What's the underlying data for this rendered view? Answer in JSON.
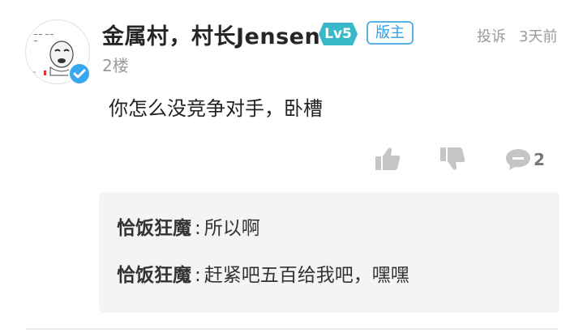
{
  "post": {
    "username": "金属村，村长Jensen",
    "level": "Lv5",
    "owner_badge": "版主",
    "report": "投诉",
    "time": "3天前",
    "floor": "2楼",
    "content": "你怎么没竞争对手，卧槽",
    "reply_count": "2"
  },
  "replies": [
    {
      "author": "恰饭狂魔",
      "sep": ":",
      "text": "所以啊"
    },
    {
      "author": "恰饭狂魔",
      "sep": ":",
      "text": "赶紧吧五百给我吧，嘿嘿"
    }
  ],
  "colors": {
    "level_badge": "#39b9c8",
    "owner_badge": "#2e9ee6",
    "verified": "#39a8f0",
    "icon_gray": "#c5c5c5"
  },
  "icons": {
    "like": "thumbs-up-icon",
    "dislike": "thumbs-down-icon",
    "reply": "comment-bubble-icon",
    "verified": "verified-check-icon"
  }
}
